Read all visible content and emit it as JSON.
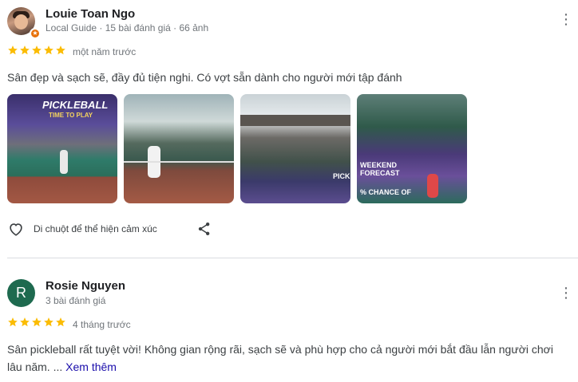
{
  "reviews": [
    {
      "name": "Louie Toan Ngo",
      "meta": "Local Guide · 15 bài đánh giá · 66 ảnh",
      "rating": 5,
      "date": "một năm trước",
      "text": "Sân đẹp và sạch sẽ, đầy đủ tiện nghi. Có vợt sẵn dành cho người mới tập đánh",
      "photos": [
        {
          "caption": "PICKLEBALL",
          "sub": "TIME TO PLAY"
        },
        {
          "caption": ""
        },
        {
          "caption": "PICKL"
        },
        {
          "caption": "WEEKEND FORECAST",
          "sub": "% CHANCE OF"
        }
      ],
      "reaction_label": "Di chuột để thể hiện cảm xúc",
      "badge_icon": "local-guide-star-icon"
    },
    {
      "name": "Rosie Nguyen",
      "avatar_letter": "R",
      "avatar_color": "#1e6a4f",
      "meta": "3 bài đánh giá",
      "rating": 5,
      "date": "4 tháng trước",
      "text_prefix": "Sân pickleball rất tuyệt vời! Không gian rộng rãi, sạch sẽ và phù hợp cho cả người mới bắt đầu lẫn người chơi lâu năm. ... ",
      "read_more": "Xem thêm"
    }
  ],
  "colors": {
    "star": "#fbbc04",
    "link": "#1a0dab",
    "muted": "#70757a",
    "divider": "#dadce0"
  }
}
